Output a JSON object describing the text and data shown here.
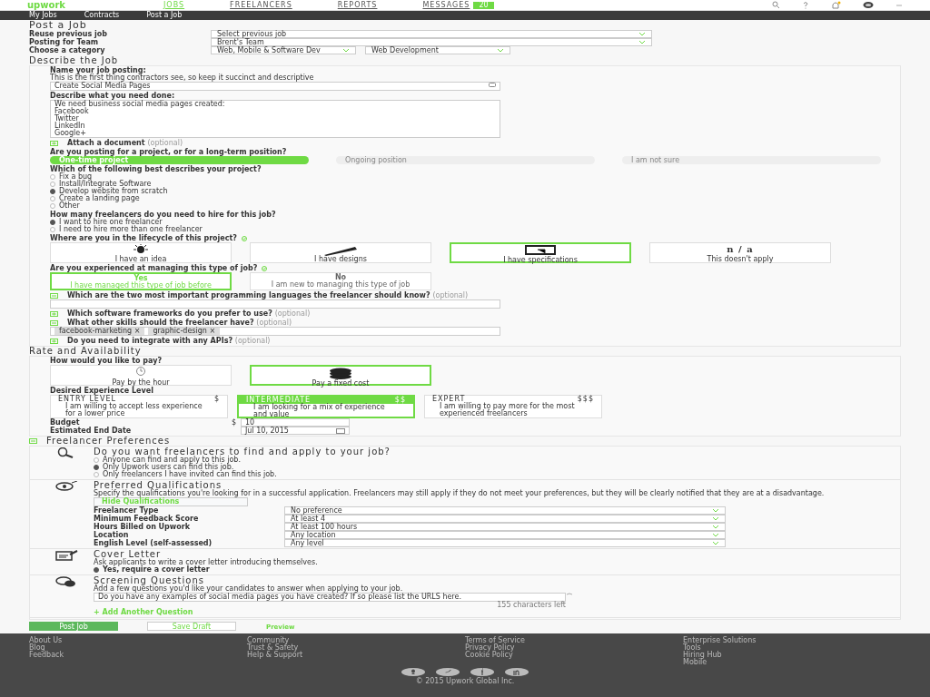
{
  "header": {
    "logo": "upwork",
    "nav": [
      {
        "label": "JOBS",
        "selected": true
      },
      {
        "label": "FREELANCERS",
        "selected": false
      },
      {
        "label": "REPORTS",
        "selected": false
      },
      {
        "label": "MESSAGES",
        "selected": false,
        "badge": "20"
      }
    ]
  },
  "subnav": [
    "My Jobs",
    "Contracts",
    "Post a Job"
  ],
  "page_title": "Post a Job",
  "top_fields": [
    {
      "label": "Reuse previous job",
      "values": [
        "Select previous job"
      ]
    },
    {
      "label": "Posting for Team",
      "values": [
        "Brent's Team"
      ]
    },
    {
      "label": "Choose a category",
      "values": [
        "Web, Mobile & Software Dev",
        "Web Development"
      ]
    }
  ],
  "describe": {
    "title": "Describe the Job",
    "name_label": "Name your job posting:",
    "name_hint": "This is the first thing contractors see, so keep it succinct and descriptive",
    "name_value": "Create Social Media Pages",
    "desc_label": "Describe what you need done:",
    "desc_value": "We need business social media pages created:\nFacebook\nTwitter\nLinkedIn\nGoogle+",
    "attach_expanded": false,
    "attach": "Attach a document",
    "attach_optional": "(optional)",
    "project_question": "Are you posting for a project, or for a long-term position?",
    "project_options": [
      {
        "label": "One-time project",
        "selected": true
      },
      {
        "label": "Ongoing position",
        "selected": false
      },
      {
        "label": "I am not sure",
        "selected": false
      }
    ],
    "type_question": "Which of the following best describes your project?",
    "type_options": [
      {
        "label": "Fix a bug",
        "selected": false
      },
      {
        "label": "Install/Integrate Software",
        "selected": false
      },
      {
        "label": "Develop website from scratch",
        "selected": true
      },
      {
        "label": "Create a landing page",
        "selected": false
      },
      {
        "label": "Other",
        "selected": false
      }
    ],
    "count_question": "How many freelancers do you need to hire for this job?",
    "count_options": [
      {
        "label": "I want to hire one freelancer",
        "selected": true
      },
      {
        "label": "I need to hire more than one freelancer",
        "selected": false
      }
    ],
    "lifecycle_question": "Where are you in the lifecycle of this project?",
    "lifecycle_options": [
      {
        "kind": "idea",
        "label": "I have an idea",
        "selected": false
      },
      {
        "kind": "designs",
        "label": "I have designs",
        "selected": false
      },
      {
        "kind": "specs",
        "label": "I have specifications",
        "selected": true
      },
      {
        "kind": "na",
        "icon_text": "n / a",
        "label": "This doesn't apply",
        "selected": false
      }
    ],
    "experience_question": "Are you experienced at managing this type of job?",
    "experience_options": [
      {
        "title": "Yes",
        "text": "I have managed this type of job before",
        "selected": true
      },
      {
        "title": "No",
        "text": "I am new to managing this type of job",
        "selected": false
      }
    ],
    "optional_questions": [
      {
        "text": "Which are the two most important programming languages the freelancer should know?",
        "optional": "(optional)",
        "expanded": true
      },
      {
        "text": "Which software frameworks do you prefer to use?",
        "optional": "(optional)",
        "expanded": false
      },
      {
        "text": "What other skills should the freelancer have?",
        "optional": "(optional)",
        "expanded": true,
        "tags": [
          "facebook-marketing ×",
          "graphic-design ×"
        ]
      },
      {
        "text": "Do you need to integrate with any APIs?",
        "optional": "(optional)",
        "expanded": false
      }
    ]
  },
  "rate": {
    "title": "Rate and Availability",
    "pay_question": "How would you like to pay?",
    "pay_options": [
      {
        "kind": "hourly",
        "label": "Pay by the hour",
        "selected": false
      },
      {
        "kind": "fixed",
        "label": "Pay a fixed cost",
        "selected": true
      }
    ],
    "level_label": "Desired Experience Level",
    "levels": [
      {
        "name": "ENTRY LEVEL",
        "price": "$",
        "text": "I am willing to accept less experience for a lower price",
        "selected": false
      },
      {
        "name": "INTERMEDIATE",
        "price": "$$",
        "text": "I am looking for a mix of experience and value",
        "selected": true
      },
      {
        "name": "EXPERT",
        "price": "$$$",
        "text": "I am willing to pay more for the most experienced freelancers",
        "selected": false
      }
    ],
    "budget_label": "Budget",
    "currency": "$",
    "budget": "10",
    "date_label": "Estimated End Date",
    "date": "Jul 10, 2015"
  },
  "prefs": {
    "expanded": true,
    "title": "Freelancer Preferences",
    "visibility": {
      "title": "Do you want freelancers to find and apply to your job?",
      "options": [
        {
          "label": "Anyone can find and apply to this job.",
          "selected": false
        },
        {
          "label": "Only Upwork users can find this job.",
          "selected": true
        },
        {
          "label": "Only freelancers I have invited can find this job.",
          "selected": false
        }
      ]
    },
    "qualifications": {
      "title": "Preferred Qualifications",
      "text": "Specify the qualifications you're looking for in a successful application. Freelancers may still apply if they do not meet your preferences, but they will be clearly notified that they are at a disadvantage.",
      "button": "Hide Qualifications",
      "rows": [
        {
          "label": "Freelancer Type",
          "value": "No preference"
        },
        {
          "label": "Minimum Feedback Score",
          "value": "At least 4"
        },
        {
          "label": "Hours Billed on Upwork",
          "value": "At least 100 hours"
        },
        {
          "label": "Location",
          "value": "Any location"
        },
        {
          "label": "English Level (self-assessed)",
          "value": "Any level"
        }
      ]
    },
    "cover": {
      "title": "Cover Letter",
      "text": "Ask applicants to write a cover letter introducing themselves.",
      "checkbox": "Yes, require a cover letter",
      "checked": true
    },
    "screening": {
      "title": "Screening Questions",
      "text": "Add a few questions you'd like your candidates to answer when applying to your job.",
      "question": "Do you have any examples of social media pages you have created? If so please list the URLS here.",
      "counter": "155 characters left",
      "add": "+ Add Another Question"
    }
  },
  "actions": [
    "Post Job",
    "Save Draft",
    "Preview"
  ],
  "footer": {
    "columns": [
      [
        "About Us",
        "Blog",
        "Feedback"
      ],
      [
        "Community",
        "Trust & Safety",
        "Help & Support"
      ],
      [
        "Terms of Service",
        "Privacy Policy",
        "Cookie Policy"
      ],
      [
        "Enterprise Solutions",
        "Tools",
        "Hiring Hub",
        "Mobile"
      ]
    ],
    "copyright": "© 2015 Upwork Global Inc."
  }
}
